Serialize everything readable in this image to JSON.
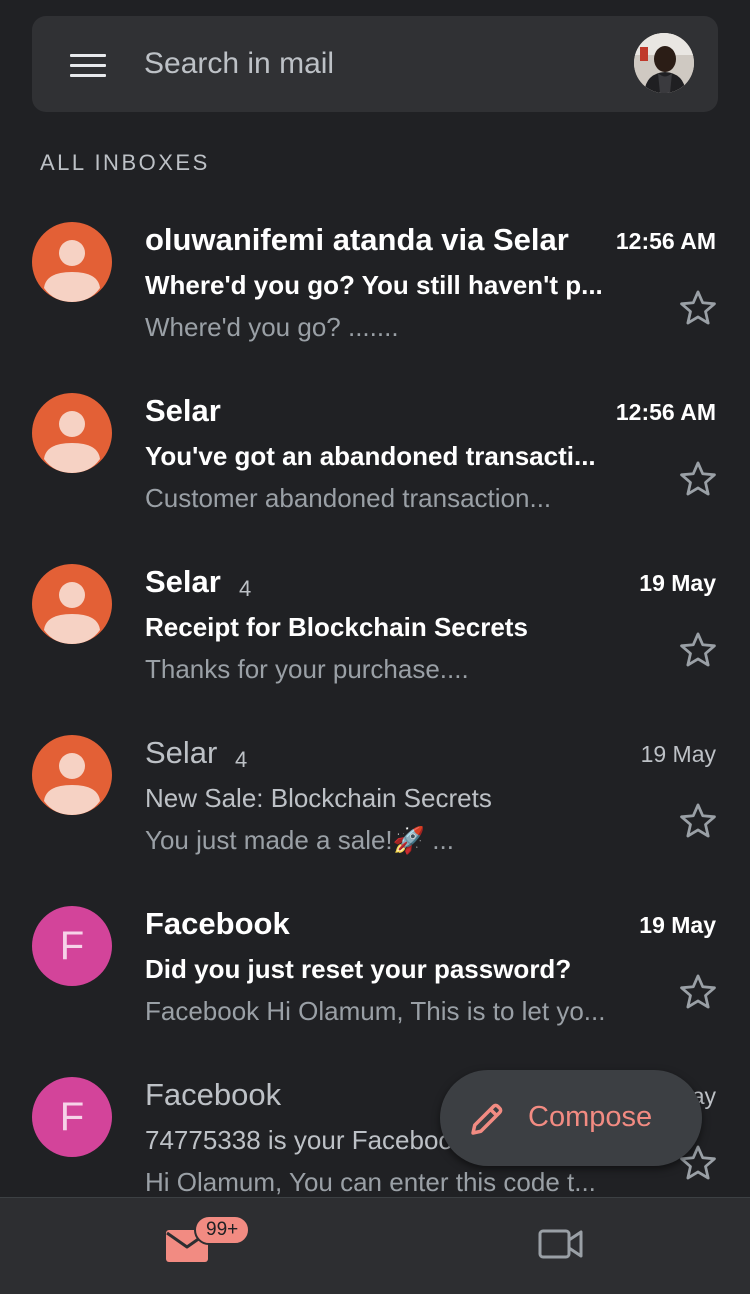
{
  "search": {
    "placeholder": "Search in mail"
  },
  "section_label": "ALL INBOXES",
  "emails": [
    {
      "sender": "oluwanifemi atanda via Selar",
      "count": "",
      "time": "12:56 AM",
      "subject": "Where'd you go? You still haven't p...",
      "snippet": "Where'd you go? .......",
      "unread": true,
      "avatar": "person"
    },
    {
      "sender": "Selar",
      "count": "",
      "time": "12:56 AM",
      "subject": "You've got an abandoned transacti...",
      "snippet": "Customer abandoned transaction...",
      "unread": true,
      "avatar": "person"
    },
    {
      "sender": "Selar",
      "count": "4",
      "time": "19 May",
      "subject": "Receipt for Blockchain Secrets",
      "snippet": "Thanks for your purchase....",
      "unread": true,
      "avatar": "person"
    },
    {
      "sender": "Selar",
      "count": "4",
      "time": "19 May",
      "subject": "New Sale: Blockchain Secrets",
      "snippet": "You just made a sale!🚀 ...",
      "unread": false,
      "avatar": "person"
    },
    {
      "sender": "Facebook",
      "count": "",
      "time": "19 May",
      "subject": "Did you just reset your password?",
      "snippet": "Facebook Hi Olamum, This is to let yo...",
      "unread": true,
      "avatar": "F"
    },
    {
      "sender": "Facebook",
      "count": "",
      "time": "19 May",
      "subject": "74775338 is your Facebook",
      "snippet": "Hi Olamum, You can enter this code t...",
      "unread": false,
      "avatar": "F"
    }
  ],
  "compose": {
    "label": "Compose"
  },
  "nav": {
    "mail_badge": "99+"
  },
  "colors": {
    "background": "#202124",
    "person_avatar": "#e36036",
    "letter_avatar": "#d3449a",
    "accent": "#f28b82"
  }
}
